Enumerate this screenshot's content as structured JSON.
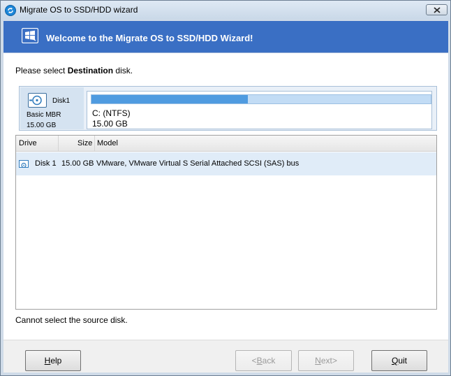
{
  "window": {
    "title": "Migrate OS to SSD/HDD wizard",
    "icons": {
      "app": "refresh-arrows-icon",
      "close": "close-icon"
    }
  },
  "banner": {
    "title": "Welcome to the Migrate OS to SSD/HDD Wizard!",
    "icon": "windows-migrate-icon",
    "color": "#3a6fc4"
  },
  "prompt": {
    "before": "Please select ",
    "emphasis": "Destination",
    "after": " disk."
  },
  "disk_map": {
    "disk_name": "Disk1",
    "disk_type": "Basic MBR",
    "disk_size": "15.00 GB",
    "partition_label": "C: (NTFS)",
    "partition_size": "15.00 GB",
    "used_fraction": 0.46,
    "bar_color": "#4f9be0"
  },
  "table": {
    "columns": [
      "Drive",
      "Size",
      "Model"
    ],
    "rows": [
      {
        "drive": "Disk 1",
        "size": "15.00 GB",
        "model": "VMware,  VMware Virtual S Serial Attached SCSI (SAS) bus"
      }
    ]
  },
  "status_text": "Cannot select the source disk.",
  "buttons": {
    "help": {
      "pre": "",
      "key": "H",
      "post": "elp"
    },
    "back": {
      "pre": "<",
      "key": "B",
      "post": "ack"
    },
    "next": {
      "pre": "",
      "key": "N",
      "post": "ext>"
    },
    "quit": {
      "pre": "",
      "key": "Q",
      "post": "uit"
    }
  }
}
